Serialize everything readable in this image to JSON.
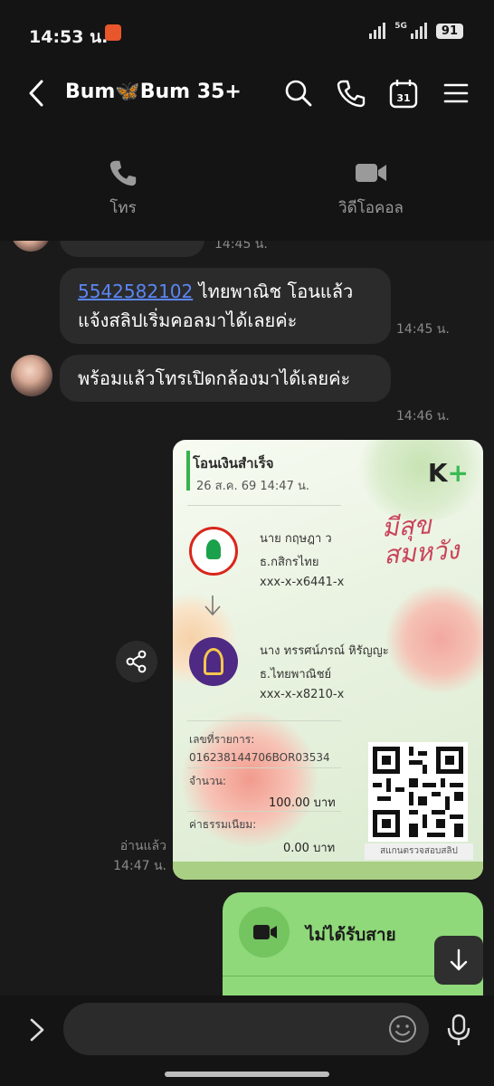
{
  "status": {
    "time": "14:53 น.",
    "network": "5G",
    "battery": "91"
  },
  "header": {
    "title": "Bum🦋Bum 35+",
    "calendar_day": "31"
  },
  "call_panel": {
    "voice_label": "โทร",
    "video_label": "วิดีโอคอล"
  },
  "messages": [
    {
      "time": "14:45 น."
    },
    {
      "link": "5542582102",
      "text": " ไทยพาณิช โอนแล้ว แจ้งสลิปเริ่มคอลมาได้เลยค่ะ",
      "time": "14:45 น."
    },
    {
      "text": "พร้อมแล้วโทรเปิดกล้องมาได้เลยค่ะ",
      "time": "14:46 น."
    }
  ],
  "slip": {
    "title": "โอนเงินสำเร็จ",
    "datetime": "26 ส.ค. 69  14:47 น.",
    "brand": "K",
    "brand_plus": "+",
    "script_line1": "มีสุข",
    "script_line2": "สมหวัง",
    "sender_name": "นาย กฤษฎา ว",
    "sender_bank": "ธ.กสิกรไทย",
    "sender_account": "xxx-x-x6441-x",
    "receiver_name": "นาง ทรรศน์ภรณ์ หิรัญญะ",
    "receiver_bank": "ธ.ไทยพาณิชย์",
    "receiver_account": "xxx-x-x8210-x",
    "ref_label": "เลขที่รายการ:",
    "ref_value": "016238144706BOR03534",
    "amount_label": "จำนวน:",
    "amount_value": "100.00 บาท",
    "fee_label": "ค่าธรรมเนียม:",
    "fee_value": "0.00 บาท",
    "qr_caption": "สแกนตรวจสอบสลิป"
  },
  "read_receipt": {
    "label": "อ่านแล้ว",
    "time": "14:47 น."
  },
  "missed_call": {
    "label": "ไม่ได้รับสาย"
  },
  "input": {
    "placeholder": ""
  }
}
